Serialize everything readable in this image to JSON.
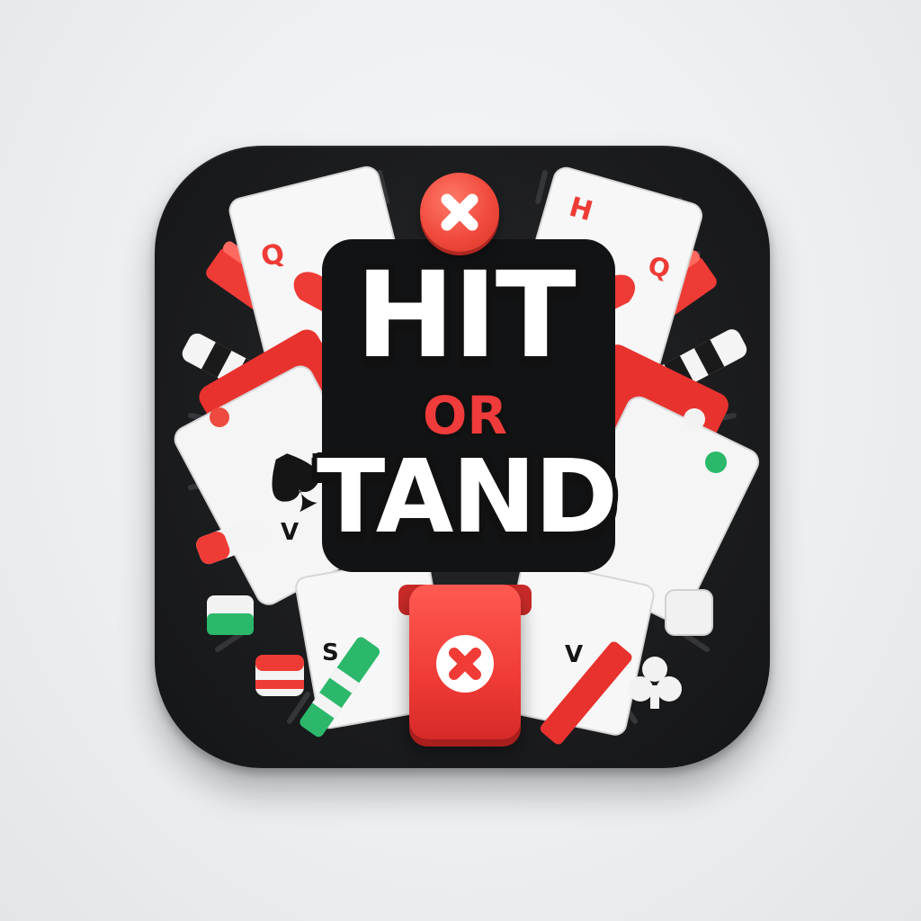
{
  "logo": {
    "title_line1": "HIT",
    "title_line2": "OR",
    "title_line3": "TAND"
  },
  "cards": {
    "top_left_rank": "Q",
    "top_right_rank": "H",
    "top_right_rank2": "Q",
    "left_rank": "V",
    "bottom_left_rank": "S",
    "bottom_right_rank": "V"
  },
  "icons": {
    "top_button": "close-icon",
    "bottom_button": "close-icon",
    "club": "club-icon",
    "heart": "heart-icon",
    "spade": "spade-icon"
  },
  "colors": {
    "tile": "#1c1d1f",
    "accent_red": "#f03b36",
    "card_white": "#f7f7f7",
    "chip_green": "#2bb86a",
    "background": "#eceef1"
  }
}
